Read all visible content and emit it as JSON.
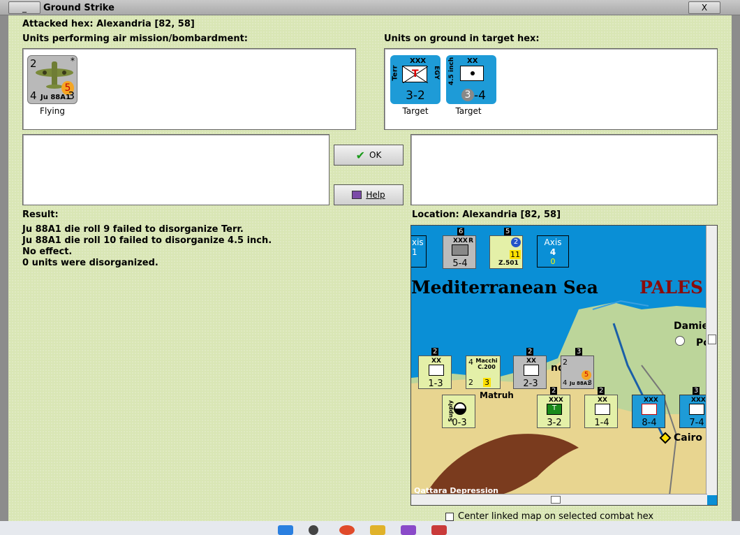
{
  "window": {
    "title": "Ground Strike",
    "minimize_glyph": "_",
    "close_glyph": "X"
  },
  "attacked_hex": "Attacked hex: Alexandria  [82, 58]",
  "air_units": {
    "heading": "Units performing air mission/bombardment:",
    "units": [
      {
        "top_left": "2",
        "top_right": "*",
        "bottom_left": "4",
        "bottom_right": "3",
        "name": "Ju 88A1",
        "badge": "5",
        "caption": "Flying"
      }
    ]
  },
  "ground_units": {
    "heading": "Units on ground in target hex:",
    "units": [
      {
        "size": "XXX",
        "side_left": "Terr",
        "side_right": "EGY",
        "symbol": "T",
        "value": "3-2",
        "caption": "Target"
      },
      {
        "size": "XX",
        "side_left": "4.5 inch",
        "badge": "3",
        "value": "-4",
        "caption": "Target"
      }
    ]
  },
  "buttons": {
    "ok": "OK",
    "help": "Help"
  },
  "result": {
    "heading": "Result:",
    "lines": [
      "Ju 88A1 die roll 9 failed to disorganize Terr.",
      "Ju 88A1 die roll 10 failed to disorganize 4.5 inch.",
      "No effect.",
      "0 units were disorganized."
    ]
  },
  "location": "Location:  Alexandria  [82, 58]",
  "map": {
    "sea_label": "Mediterranean Sea",
    "region_label": "PALES",
    "places": [
      "Damie",
      "Pc",
      "Matruh",
      "Cairo",
      "Qattara Depression",
      "nd"
    ],
    "counters": [
      {
        "top": "6",
        "size": "XXX",
        "value": "5-4",
        "extra": "R"
      },
      {
        "top": "5",
        "value": "11",
        "name": "Z.501",
        "badge": "2"
      },
      {
        "title": "Axis",
        "count": "4",
        "sub": "0"
      },
      {
        "top": "2",
        "size": "XX",
        "value": "1-3"
      },
      {
        "name": "Macchi C.200",
        "value": "3",
        "left": "2",
        "top_left": "4"
      },
      {
        "top": "2",
        "size": "XX",
        "value": "2-3"
      },
      {
        "top": "3",
        "name": "Ju 88A1",
        "bottom_left": "4",
        "bottom_right": "3",
        "badge": "5",
        "top_left": "2"
      },
      {
        "value": "0-3",
        "side": "Supply"
      },
      {
        "top": "2",
        "size": "XXX",
        "value": "3-2",
        "symbol": "T"
      },
      {
        "top": "2",
        "size": "XX",
        "value": "1-4"
      },
      {
        "size": "XXX",
        "value": "8-4"
      },
      {
        "top": "3",
        "size": "XXX",
        "value": "7-4"
      }
    ],
    "left_counter": {
      "title": "xis",
      "count": "1"
    }
  },
  "center_checkbox": {
    "label": "Center linked map on selected combat hex",
    "checked": false
  },
  "colors": {
    "bg": "#d9e6b5",
    "blue_counter": "#1e9bd7",
    "sea": "#0a8fd6",
    "desert": "#e8d590"
  }
}
